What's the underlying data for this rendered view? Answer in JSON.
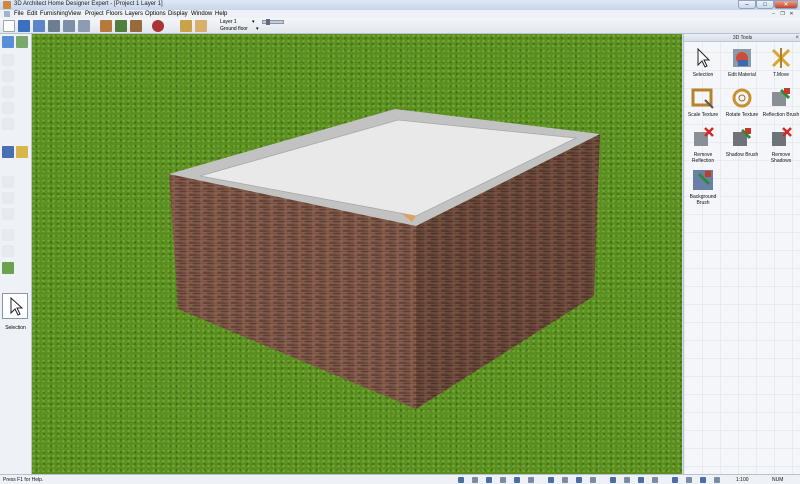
{
  "window": {
    "title": "3D Architect Home Designer Expert - [Project 1 Layer 1]"
  },
  "menu": [
    "File",
    "Edit",
    "Furnishing",
    "View",
    "Project",
    "Floors",
    "Layers",
    "Options",
    "Display",
    "Window",
    "Help"
  ],
  "toolbar": {
    "layer_label": "Layer 1",
    "floor_label": "Ground floor"
  },
  "left_panel": {
    "active_tool_label": "Selection"
  },
  "right_panel": {
    "title": "3D Tools",
    "tools": [
      {
        "label": "Selection"
      },
      {
        "label": "Edit Material"
      },
      {
        "label": "T.Move"
      },
      {
        "label": "Scale Texture"
      },
      {
        "label": "Rotate Texture"
      },
      {
        "label": "Reflection Brush"
      },
      {
        "label": "Remove Reflection"
      },
      {
        "label": "Shadow Brush"
      },
      {
        "label": "Remove Shadows"
      },
      {
        "label": "Background Brush"
      }
    ]
  },
  "status": {
    "help_text": "Press F1 for Help.",
    "scale": "1:100",
    "num": "NUM"
  },
  "colors": {
    "grass": "#5a8d22",
    "brick": "#6e4636",
    "roof": "#e9e9e9",
    "parapet": "#bfbfbf"
  }
}
